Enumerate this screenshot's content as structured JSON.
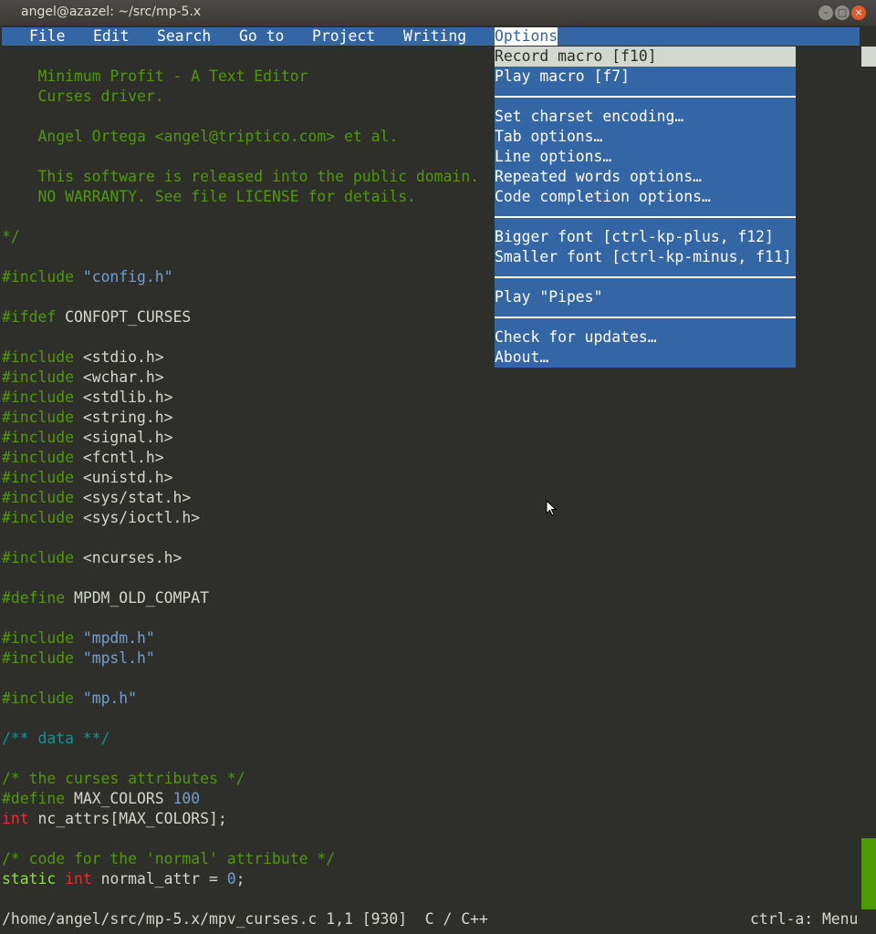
{
  "window": {
    "title": "angel@azazel: ~/src/mp-5.x"
  },
  "menubar": {
    "items": [
      "File",
      "Edit",
      "Search",
      "Go to",
      "Project",
      "Writing",
      "Options"
    ]
  },
  "options_menu": {
    "items": [
      "Record macro [f10]",
      "Play macro [f7]",
      "Set charset encoding…",
      "Tab options…",
      "Line options…",
      "Repeated words options…",
      "Code completion options…",
      "Bigger font [ctrl-kp-plus, f12]",
      "Smaller font [ctrl-kp-minus, f11]",
      "Play \"Pipes\"",
      "Check for updates…",
      "About…"
    ]
  },
  "code": {
    "header": [
      "    Minimum Profit - A Text Editor",
      "    Curses driver.",
      "",
      "    Angel Ortega <angel@triptico.com> et al.",
      "",
      "    This software is released into the public domain.",
      "    NO WARRANTY. See file LICENSE for details.",
      "",
      "*/"
    ],
    "include_config": {
      "directive": "#include",
      "arg": "\"config.h\""
    },
    "ifdef": {
      "directive": "#ifdef",
      "arg": "CONFOPT_CURSES"
    },
    "system_includes": [
      {
        "directive": "#include",
        "arg": "<stdio.h>"
      },
      {
        "directive": "#include",
        "arg": "<wchar.h>"
      },
      {
        "directive": "#include",
        "arg": "<stdlib.h>"
      },
      {
        "directive": "#include",
        "arg": "<string.h>"
      },
      {
        "directive": "#include",
        "arg": "<signal.h>"
      },
      {
        "directive": "#include",
        "arg": "<fcntl.h>"
      },
      {
        "directive": "#include",
        "arg": "<unistd.h>"
      },
      {
        "directive": "#include",
        "arg": "<sys/stat.h>"
      },
      {
        "directive": "#include",
        "arg": "<sys/ioctl.h>"
      }
    ],
    "ncurses": {
      "directive": "#include",
      "arg": "<ncurses.h>"
    },
    "define_compat": {
      "directive": "#define",
      "arg": "MPDM_OLD_COMPAT"
    },
    "mp_includes": [
      {
        "directive": "#include",
        "arg": "\"mpdm.h\""
      },
      {
        "directive": "#include",
        "arg": "\"mpsl.h\""
      }
    ],
    "mp_h": {
      "directive": "#include",
      "arg": "\"mp.h\""
    },
    "data_comment": "/** data **/",
    "attr_comment": "/* the curses attributes */",
    "define_colors": {
      "directive": "#define",
      "name": "MAX_COLORS",
      "value": "100"
    },
    "nc_attrs": {
      "type": "int",
      "rest": " nc_attrs[MAX_COLORS];"
    },
    "normal_comment": "/* code for the 'normal' attribute */",
    "normal_attr": {
      "kw": "static",
      "type": "int",
      "name": " normal_attr = ",
      "value": "0",
      "end": ";"
    }
  },
  "status": {
    "left": "/home/angel/src/mp-5.x/mpv_curses.c 1,1 [930]  C / C++",
    "right": "ctrl-a: Menu"
  },
  "colors": {
    "background": "#2e2e2b",
    "menu": "#3465a4",
    "comment": "#4e9a06",
    "string": "#729fcf",
    "type": "#ef2929",
    "doc_comment": "#06989a"
  }
}
